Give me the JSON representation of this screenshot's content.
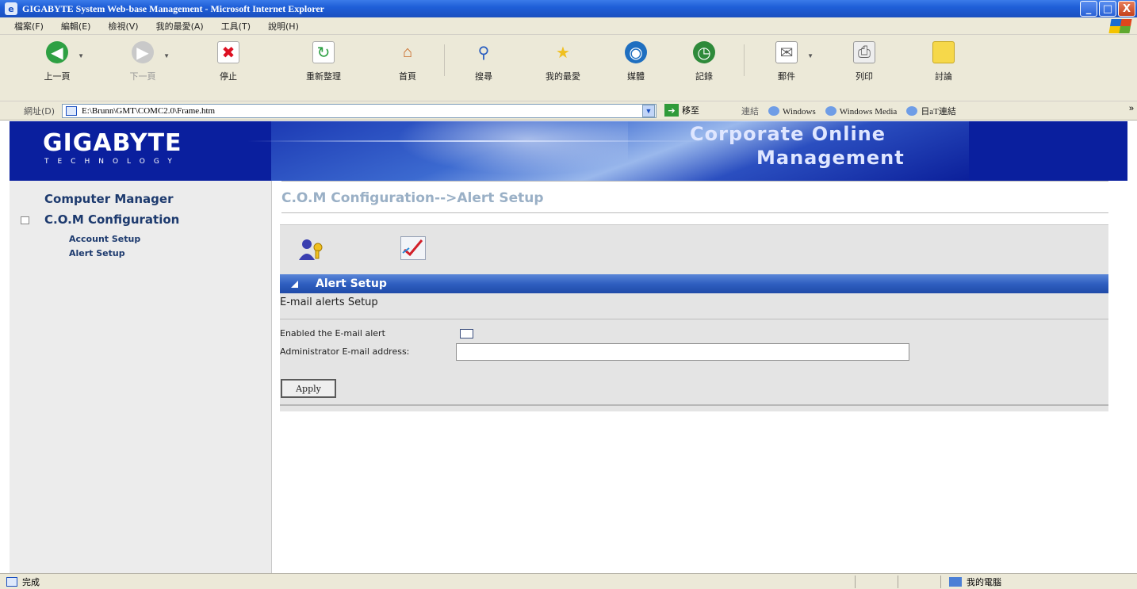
{
  "window": {
    "title": "GIGABYTE System Web-base Management - Microsoft Internet Explorer",
    "minimize": "_",
    "maximize": "□",
    "close": "X"
  },
  "menubar": [
    "檔案(F)",
    "編輯(E)",
    "檢視(V)",
    "我的最愛(A)",
    "工具(T)",
    "說明(H)"
  ],
  "toolbar": {
    "back": "上一頁",
    "forward": "下一頁",
    "stop": "停止",
    "refresh": "重新整理",
    "home": "首頁",
    "search": "搜尋",
    "favorites": "我的最愛",
    "media": "媒體",
    "history": "記錄",
    "mail": "郵件",
    "print": "列印",
    "discuss": "討論"
  },
  "addressbar": {
    "label": "網址(D)",
    "url": "E:\\Brunn\\GMT\\COMC2.0\\Frame.htm",
    "go": "移至",
    "links_label": "連結",
    "links": [
      "Windows",
      "Windows Media",
      "日aT連結"
    ],
    "more": "»"
  },
  "banner": {
    "logo": "GIGABYTE",
    "logo_sub": "TECHNOLOGY",
    "title_line1": "Corporate Online",
    "title_line2": "Management"
  },
  "sidebar": {
    "computer_manager": "Computer Manager",
    "com_configuration": "C.O.M Configuration",
    "items": [
      {
        "label": "Account Setup"
      },
      {
        "label": "Alert Setup"
      }
    ]
  },
  "main": {
    "page_title": "C.O.M Configuration-->Alert Setup",
    "section_title": "Alert Setup",
    "subsection": "E-mail alerts Setup",
    "enable_label": "Enabled the E-mail alert",
    "enable_checked": false,
    "admin_label": "Administrator E-mail address:",
    "admin_value": "",
    "apply_label": "Apply"
  },
  "status": {
    "text": "完成",
    "zone": "我的電腦"
  },
  "colors": {
    "banner_bg": "#0a1f9e",
    "section_bar": "#2f5fc0",
    "sidebar_text": "#1d3a6e",
    "page_title": "#9ab0c6"
  }
}
